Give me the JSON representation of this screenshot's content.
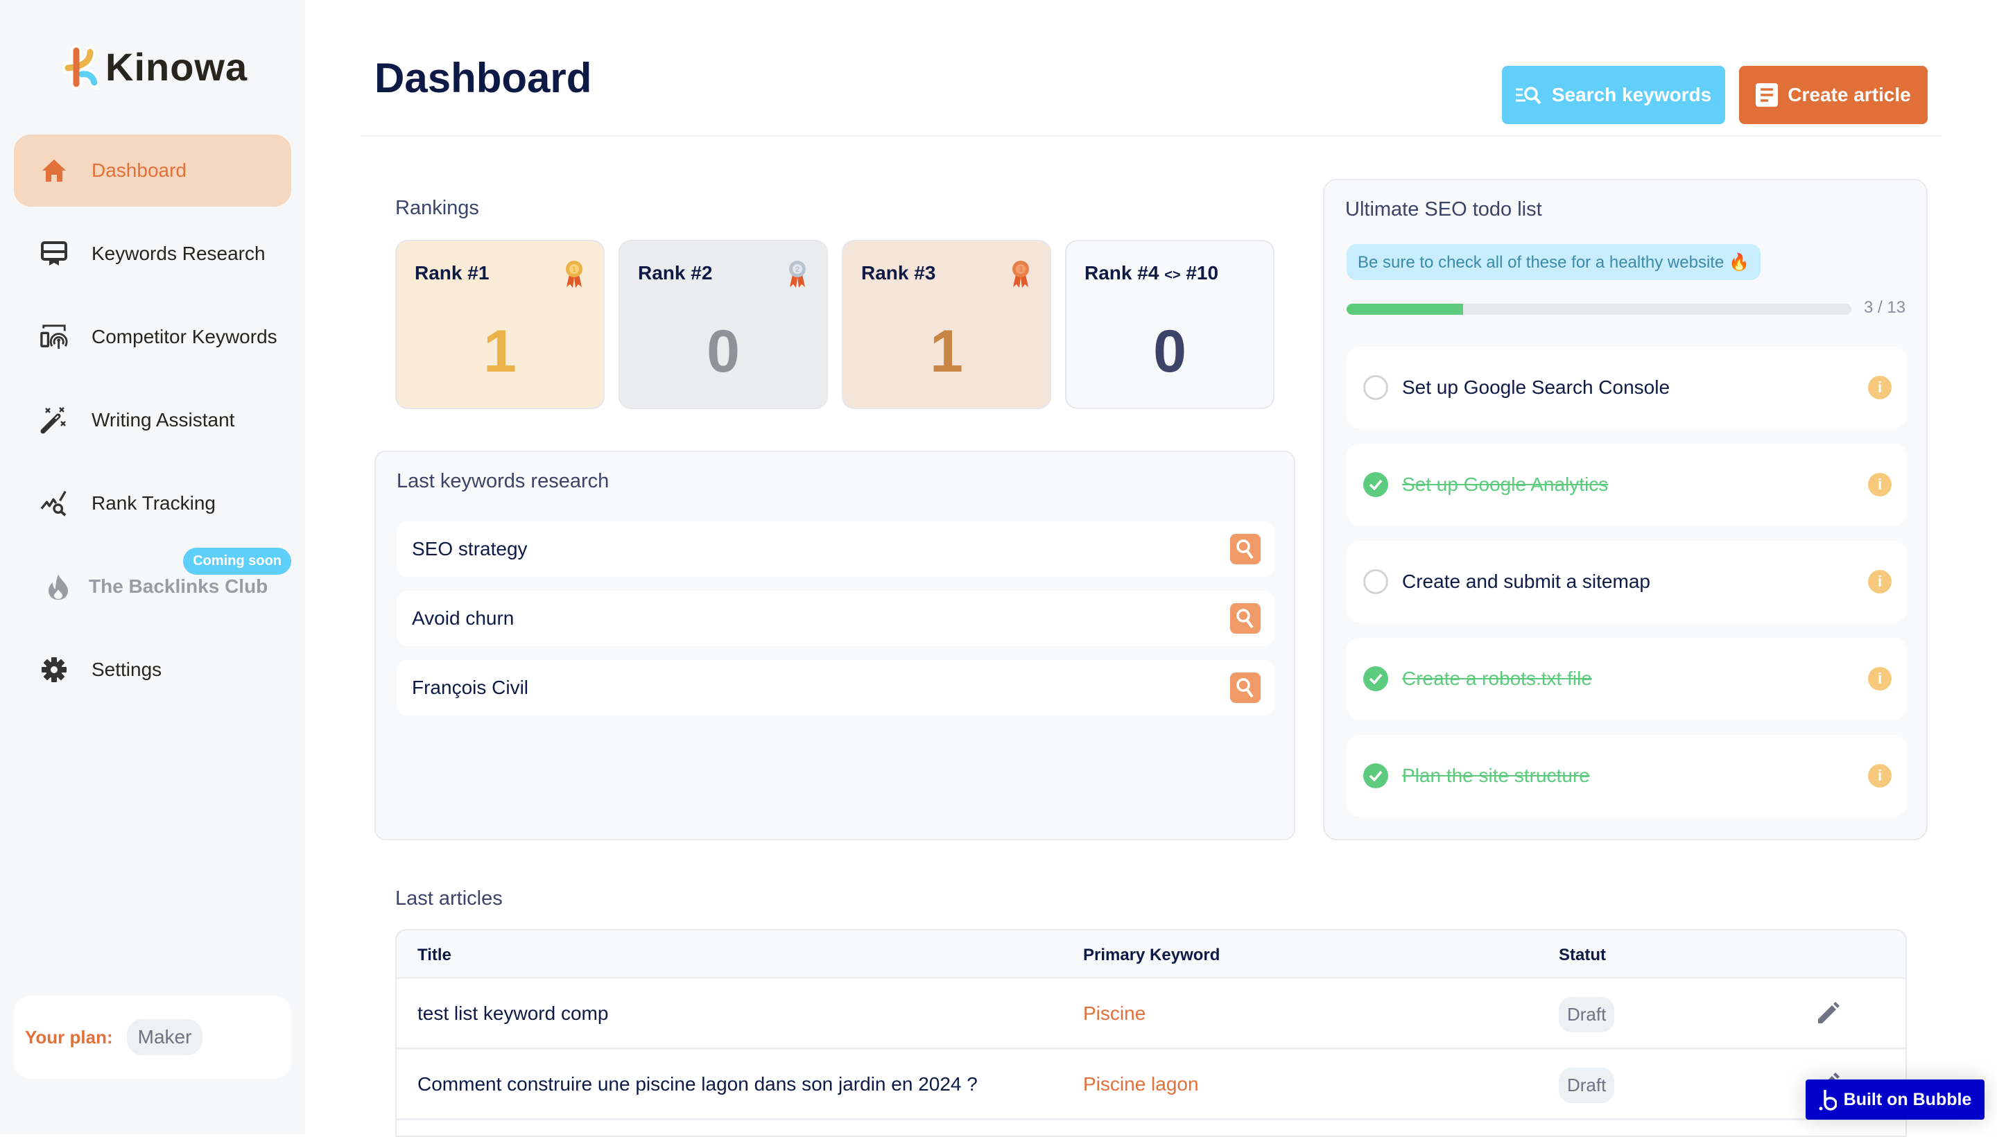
{
  "app": {
    "name": "Kinowa"
  },
  "sidebar": {
    "items": [
      {
        "label": "Dashboard",
        "icon": "home-icon",
        "active": true
      },
      {
        "label": "Keywords Research",
        "icon": "keyword-card-icon"
      },
      {
        "label": "Competitor Keywords",
        "icon": "competitor-broadcast-icon"
      },
      {
        "label": "Writing Assistant",
        "icon": "magic-wand-icon"
      },
      {
        "label": "Rank Tracking",
        "icon": "rank-chart-search-icon"
      },
      {
        "label": "The Backlinks Club",
        "icon": "fire-icon",
        "disabled": true,
        "badge": "Coming soon"
      },
      {
        "label": "Settings",
        "icon": "gear-icon"
      }
    ],
    "plan": {
      "label": "Your plan:",
      "value": "Maker"
    }
  },
  "header": {
    "title": "Dashboard",
    "search_button": "Search keywords",
    "create_button": "Create article"
  },
  "rankings": {
    "title": "Rankings",
    "cards": [
      {
        "label": "Rank #1",
        "value": "1",
        "medal": "gold",
        "bg": "#f9ebd6",
        "color": "#ecb24a"
      },
      {
        "label": "Rank #2",
        "value": "0",
        "medal": "silver",
        "bg": "#ebeced",
        "color": "#8f9299"
      },
      {
        "label": "Rank #3",
        "value": "1",
        "medal": "bronze",
        "bg": "#f5e5d8",
        "color": "#c98543"
      },
      {
        "label": "Rank #4",
        "label_sep": "<>",
        "label_end": "#10",
        "value": "0",
        "bg": "#f8f9fb",
        "color": "#3b4468"
      }
    ]
  },
  "keywords": {
    "title": "Last keywords research",
    "items": [
      "SEO strategy",
      "Avoid churn",
      "François Civil"
    ]
  },
  "todo": {
    "title": "Ultimate SEO todo list",
    "tip": "Be sure to check all of these for a healthy website 🔥",
    "progress": {
      "done": 3,
      "total": 13,
      "label": "3 / 13"
    },
    "items": [
      {
        "label": "Set up Google Search Console",
        "done": false
      },
      {
        "label": "Set up Google Analytics",
        "done": true
      },
      {
        "label": "Create and submit a sitemap",
        "done": false
      },
      {
        "label": "Create a robots.txt file",
        "done": true
      },
      {
        "label": "Plan the site structure",
        "done": true
      }
    ]
  },
  "articles": {
    "title": "Last articles",
    "columns": [
      "Title",
      "Primary Keyword",
      "Statut"
    ],
    "rows": [
      {
        "title": "test list keyword comp",
        "keyword": "Piscine",
        "status": "Draft"
      },
      {
        "title": "Comment construire une piscine lagon dans son jardin en 2024 ?",
        "keyword": "Piscine lagon",
        "status": "Draft"
      }
    ]
  },
  "bubble_badge": "Built on Bubble",
  "colors": {
    "accent": "#e2703a",
    "secondary": "#62cefa",
    "success": "#5ccb7d",
    "navy": "#0d1a45"
  }
}
